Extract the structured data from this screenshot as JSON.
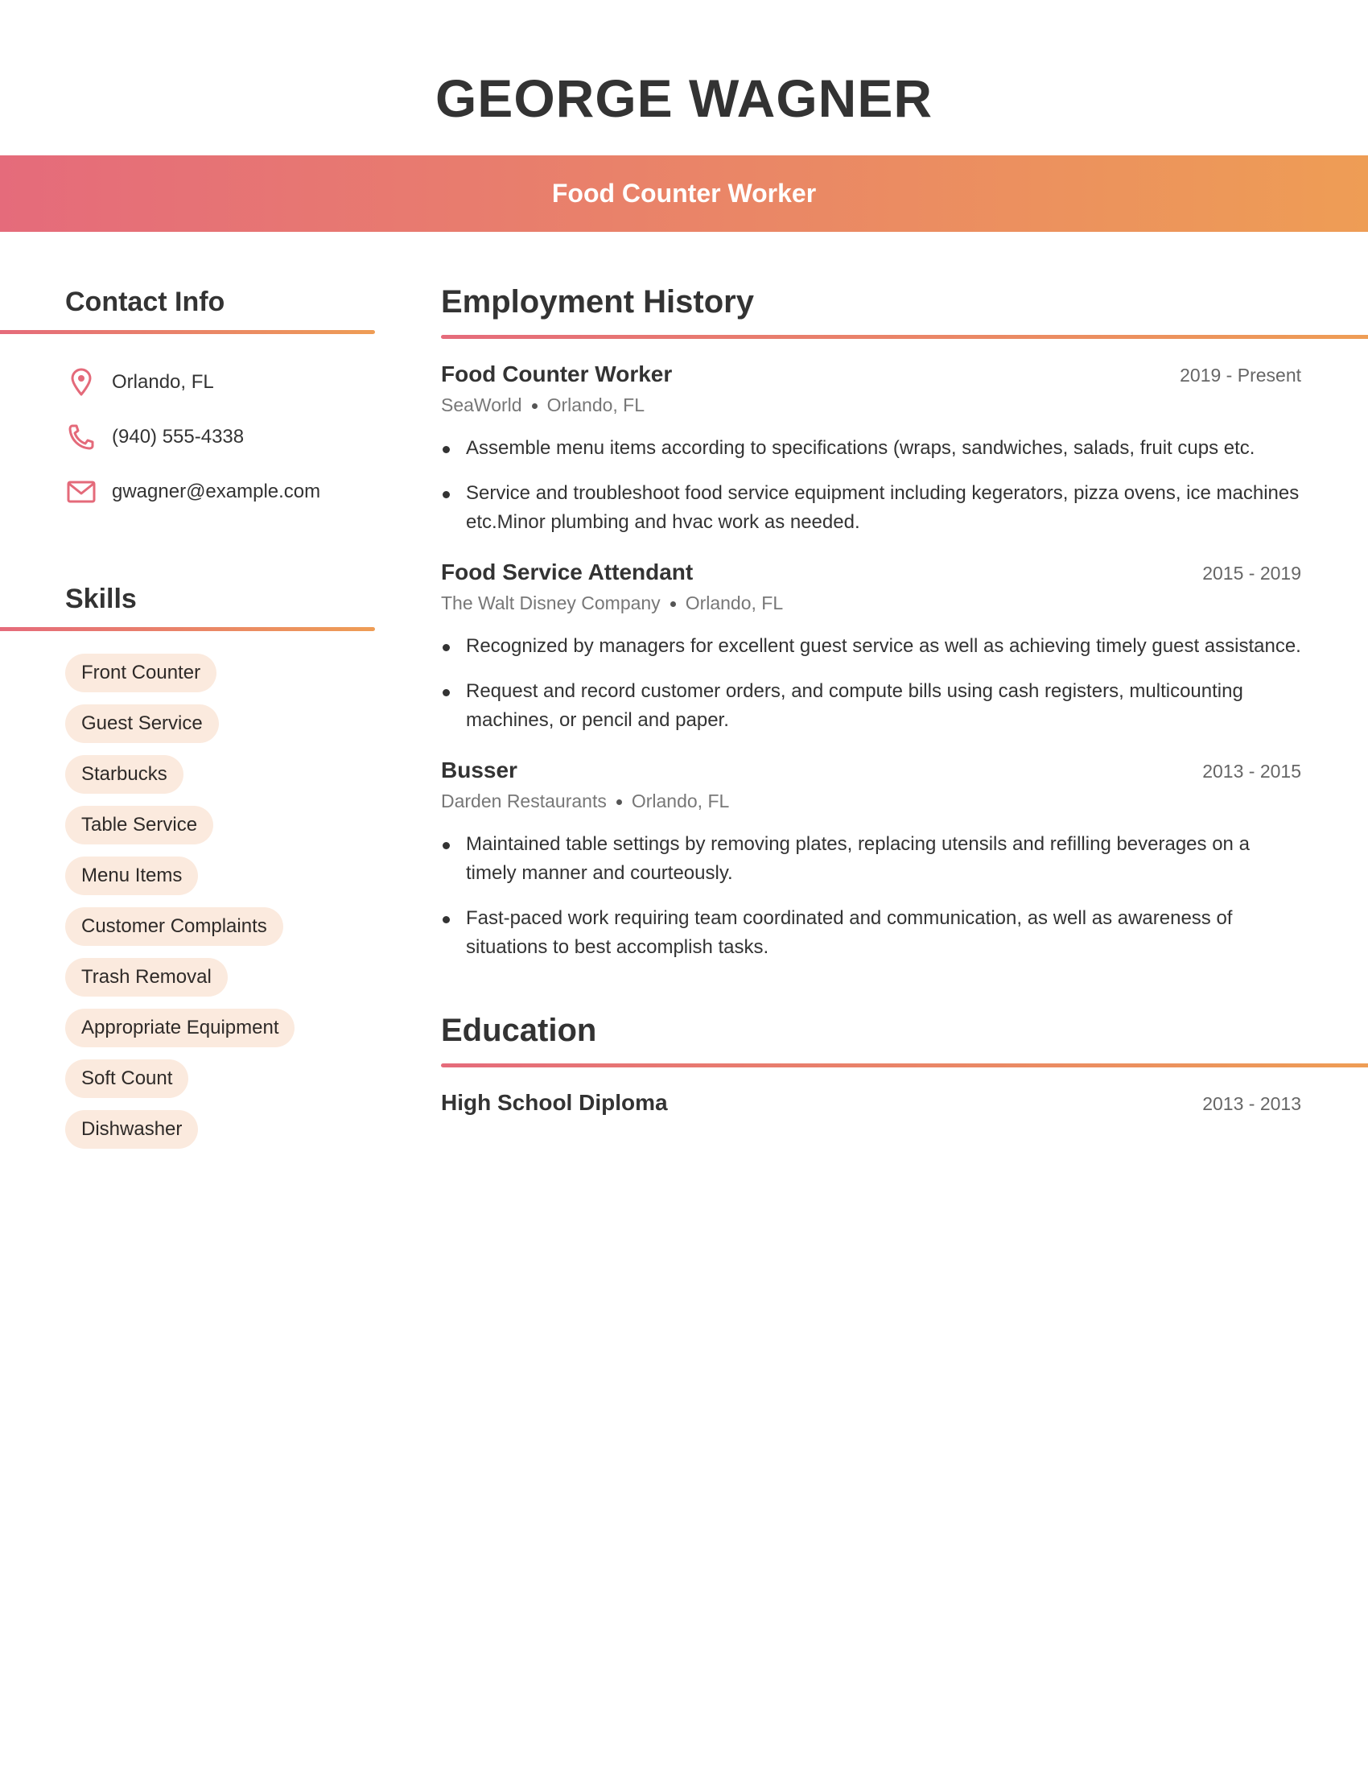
{
  "header": {
    "name": "GEORGE WAGNER",
    "title": "Food Counter Worker",
    "gradient": [
      "#e56b7b",
      "#ee9d55"
    ]
  },
  "contact": {
    "heading": "Contact Info",
    "items": [
      {
        "icon": "location-pin-icon",
        "text": "Orlando, FL"
      },
      {
        "icon": "phone-icon",
        "text": "(940) 555-4338"
      },
      {
        "icon": "envelope-icon",
        "text": "gwagner@example.com"
      }
    ],
    "icon_color": "#e46a7a"
  },
  "skills": {
    "heading": "Skills",
    "items": [
      "Front Counter",
      "Guest Service",
      "Starbucks",
      "Table Service",
      "Menu Items",
      "Customer Complaints",
      "Trash Removal",
      "Appropriate Equipment",
      "Soft Count",
      "Dishwasher"
    ],
    "chip_color": "#fbeade"
  },
  "employment": {
    "heading": "Employment History",
    "jobs": [
      {
        "title": "Food Counter Worker",
        "dates": "2019 - Present",
        "company": "SeaWorld",
        "location": "Orlando, FL",
        "bullets": [
          "Assemble menu items according to specifications (wraps, sandwiches, salads, fruit cups etc.",
          "Service and troubleshoot food service equipment including kegerators, pizza ovens, ice machines etc.Minor plumbing and hvac work as needed."
        ]
      },
      {
        "title": "Food Service Attendant",
        "dates": "2015 - 2019",
        "company": "The Walt Disney Company",
        "location": "Orlando, FL",
        "bullets": [
          "Recognized by managers for excellent guest service as well as achieving timely guest assistance.",
          "Request and record customer orders, and compute bills using cash registers, multicounting machines, or pencil and paper."
        ]
      },
      {
        "title": "Busser",
        "dates": "2013 - 2015",
        "company": "Darden Restaurants",
        "location": "Orlando, FL",
        "bullets": [
          "Maintained table settings by removing plates, replacing utensils and refilling beverages on a timely manner and courteously.",
          "Fast-paced work requiring team coordinated and communication, as well as awareness of situations to best accomplish tasks."
        ]
      }
    ]
  },
  "education": {
    "heading": "Education",
    "items": [
      {
        "title": "High School Diploma",
        "dates": "2013 - 2013"
      }
    ]
  }
}
